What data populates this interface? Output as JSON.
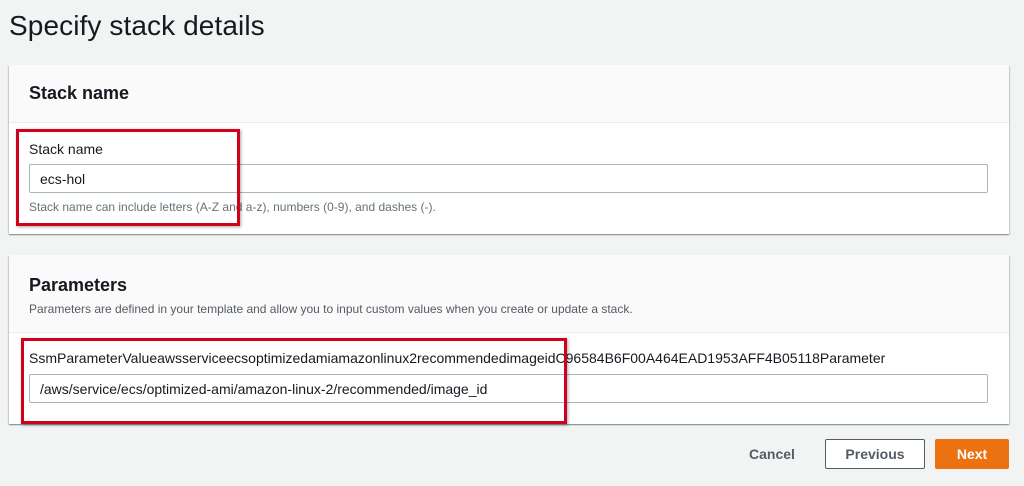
{
  "page": {
    "title": "Specify stack details"
  },
  "stack_name_panel": {
    "title": "Stack name",
    "field_label": "Stack name",
    "field_value": "ecs-hol",
    "constraint": "Stack name can include letters (A-Z and a-z), numbers (0-9), and dashes (-)."
  },
  "parameters_panel": {
    "title": "Parameters",
    "description": "Parameters are defined in your template and allow you to input custom values when you create or update a stack.",
    "params": [
      {
        "label": "SsmParameterValueawsserviceecsoptimizedamiamazonlinux2recommendedimageidC96584B6F00A464EAD1953AFF4B05118Parameter",
        "value": "/aws/service/ecs/optimized-ami/amazon-linux-2/recommended/image_id"
      }
    ]
  },
  "footer": {
    "cancel_label": "Cancel",
    "previous_label": "Previous",
    "next_label": "Next"
  },
  "colors": {
    "primary_button": "#ec7211",
    "highlight_box": "#d0021b",
    "page_background": "#f2f3f3"
  }
}
